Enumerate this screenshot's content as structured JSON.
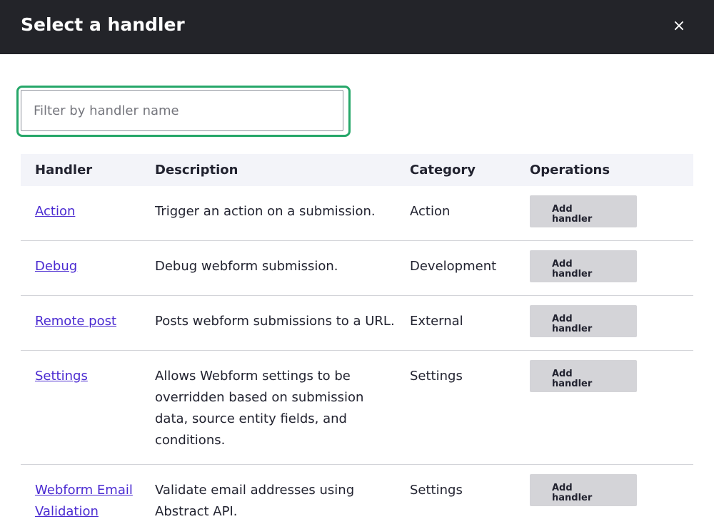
{
  "dialog": {
    "title": "Select a handler",
    "close_label": "×"
  },
  "filter": {
    "placeholder": "Filter by handler name",
    "value": ""
  },
  "table": {
    "headers": {
      "handler": "Handler",
      "description": "Description",
      "category": "Category",
      "operations": "Operations"
    },
    "rows": [
      {
        "handler": "Action",
        "description": "Trigger an action on a submission.",
        "category": "Action",
        "button": "Add handler"
      },
      {
        "handler": "Debug",
        "description": "Debug webform submission.",
        "category": "Development",
        "button": "Add handler"
      },
      {
        "handler": "Remote post",
        "description": "Posts webform submissions to a URL.",
        "category": "External",
        "button": "Add handler"
      },
      {
        "handler": "Settings",
        "description": "Allows Webform settings to be overridden based on submission data, source entity fields, and conditions.",
        "category": "Settings",
        "button": "Add handler"
      },
      {
        "handler": "Webform Email Validation",
        "description": "Validate email addresses using Abstract API.",
        "category": "Settings",
        "button": "Add handler"
      }
    ]
  },
  "colors": {
    "titlebar": "#232429",
    "focus_ring": "#26a769",
    "link": "#4a2ad1",
    "header_bg": "#f3f4f9",
    "button_bg": "#d4d4d8"
  },
  "icons": {
    "close": "close-icon"
  }
}
